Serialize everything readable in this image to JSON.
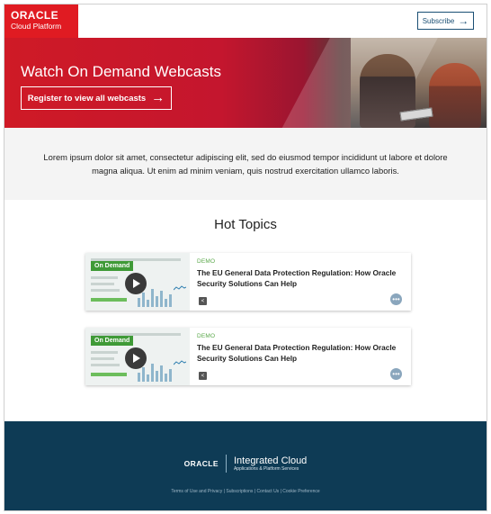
{
  "header": {
    "logo_line1": "ORACLE",
    "logo_line2": "Cloud Platform",
    "subscribe_label": "Subscribe",
    "subscribe_arrow": "→"
  },
  "hero": {
    "title": "Watch On Demand Webcasts",
    "register_label": "Register to view all webcasts",
    "register_arrow": "→"
  },
  "intro": {
    "text": "Lorem ipsum dolor sit amet, consectetur adipiscing elit, sed do eiusmod tempor incididunt ut labore et dolore magna aliqua. Ut enim ad minim veniam, quis nostrud exercitation ullamco laboris."
  },
  "hot_topics": {
    "title": "Hot Topics",
    "cards": [
      {
        "badge": "On Demand",
        "kind": "DEMO",
        "title": "The EU General Data Protection Regulation: How Oracle Security Solutions Can Help"
      },
      {
        "badge": "On Demand",
        "kind": "DEMO",
        "title": "The EU General Data Protection Regulation: How Oracle Security Solutions Can Help"
      }
    ]
  },
  "footer": {
    "logo_oracle": "ORACLE",
    "logo_title": "Integrated Cloud",
    "logo_subtitle": "Applications & Platform Services",
    "links": "Terms of Use and Privacy | Subscriptions | Contact Us | Cookie Preference"
  },
  "colors": {
    "brand_red": "#e01b22",
    "footer_navy": "#0e3b55",
    "demo_green": "#5aa84a",
    "badge_green": "#3f9a37"
  },
  "icons": [
    "arrow-right-icon",
    "play-icon",
    "share-icon",
    "more-icon"
  ]
}
